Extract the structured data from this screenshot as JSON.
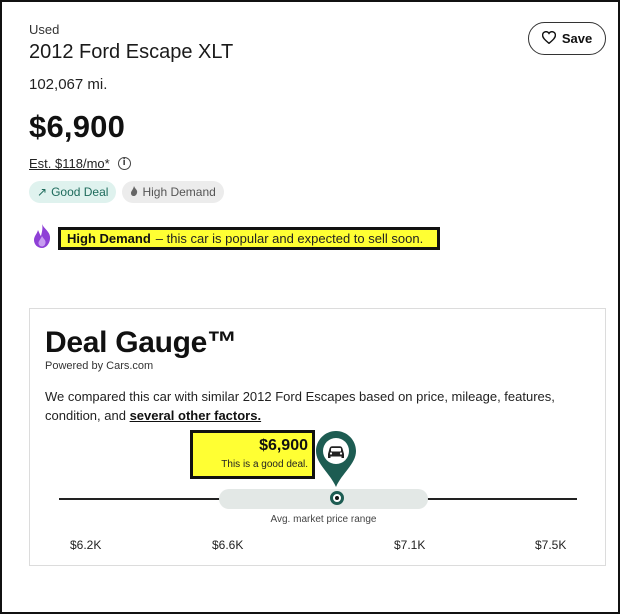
{
  "listing": {
    "condition": "Used",
    "title": "2012 Ford Escape XLT",
    "mileage": "102,067 mi.",
    "price": "$6,900",
    "estimate": "Est. $118/mo*",
    "info_glyph": "i",
    "badges": [
      {
        "label": "Good Deal",
        "icon": "trending-up-icon",
        "glyph": "↗"
      },
      {
        "label": "High Demand",
        "icon": "flame-icon",
        "glyph": "🔥"
      }
    ],
    "save_label": "Save"
  },
  "demand": {
    "strong": "High Demand",
    "text": "– this car is popular and expected to sell soon."
  },
  "gauge": {
    "title": "Deal Gauge™",
    "powered_by": "Powered by Cars.com",
    "description": "We compared this car with similar 2012 Ford Escapes based on price, mileage, features, condition, and",
    "link": "several other factors.",
    "deal_price": "$6,900",
    "deal_text": "This is a good deal.",
    "range_label": "Avg. market price range",
    "ticks": [
      "$6.2K",
      "$6.6K",
      "$7.1K",
      "$7.5K"
    ]
  },
  "colors": {
    "accent_green": "#1d5c52",
    "highlight": "#ffff33",
    "flame_purple": "#8e3fd6"
  }
}
